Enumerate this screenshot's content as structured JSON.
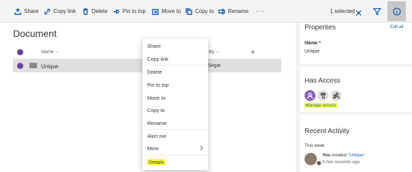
{
  "toolbar": {
    "share": "Share",
    "copy_link": "Copy link",
    "delete": "Delete",
    "pin_to_top": "Pin to top",
    "move_to": "Move to",
    "copy_to": "Copy to",
    "rename": "Rename",
    "more": "···",
    "selected_count": "1 selected"
  },
  "library": {
    "title": "Document",
    "col_name": "Name",
    "col_modified": "fied By",
    "add_column": "+",
    "row": {
      "name": "Unique",
      "modified_by": "gar Segar"
    }
  },
  "context_menu": {
    "items": [
      "Share",
      "Copy link",
      "Delete",
      "Pin to top",
      "Move to",
      "Copy to",
      "Rename",
      "Alert me",
      "More",
      "Details"
    ]
  },
  "details_panel": {
    "properties_title": "Properties",
    "edit_all": "Edit all",
    "name_label": "Name *",
    "name_value": "Unique",
    "has_access_title": "Has Access",
    "manage_access": "Manage access",
    "recent_activity_title": "Recent Activity",
    "this_week": "This week",
    "activity_you": "You",
    "activity_action": "created",
    "activity_item": "\"Unique\"",
    "activity_time": "A few seconds ago"
  },
  "colors": {
    "accent": "#0f5bb5",
    "selection_check": "#6b3fa0",
    "highlight": "#ffff40",
    "avatar_purple": "#8764b8"
  },
  "icons": [
    "share-icon",
    "link-icon",
    "trash-icon",
    "pin-icon",
    "move-icon",
    "copy-icon",
    "rename-icon",
    "close-icon",
    "filter-icon",
    "info-icon",
    "folder-icon",
    "chevron-right-icon",
    "person-icon",
    "people-icon"
  ]
}
